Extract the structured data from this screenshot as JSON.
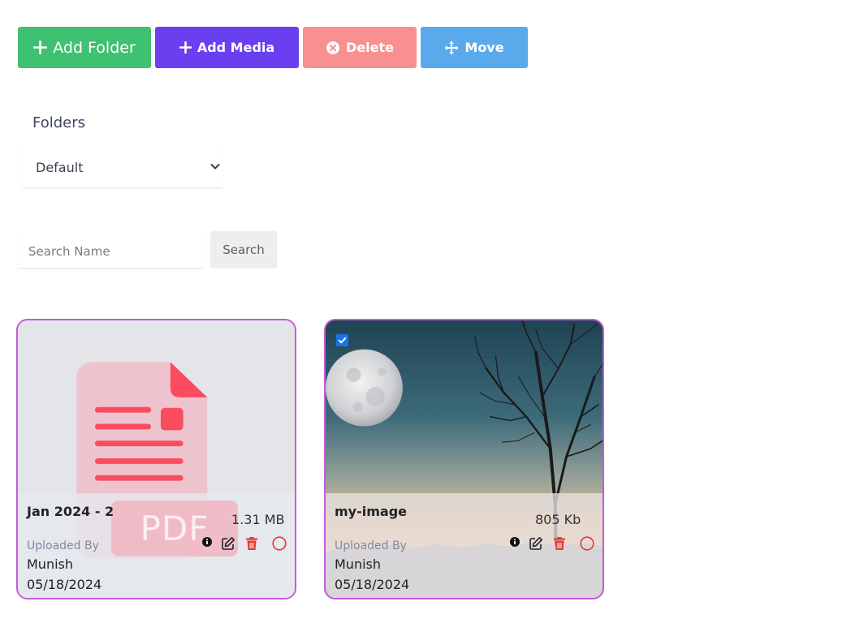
{
  "toolbar": {
    "add_folder_label": "Add Folder",
    "add_media_label": "Add Media",
    "delete_label": "Delete",
    "move_label": "Move"
  },
  "folders": {
    "label": "Folders",
    "selected": "Default"
  },
  "search": {
    "placeholder": "Search Name",
    "button_label": "Search"
  },
  "cards": [
    {
      "name": "Jan 2024 - 2",
      "size": "1.31 MB",
      "uploaded_by_label": "Uploaded By",
      "uploader": "Munish",
      "date": "05/18/2024",
      "thumb_text": "PDF",
      "thumb_icon": "pdf-file-icon",
      "checked": false
    },
    {
      "name": "my-image",
      "size": "805 Kb",
      "uploaded_by_label": "Uploaded By",
      "uploader": "Munish",
      "date": "05/18/2024",
      "thumb_icon": "moon-tree-image",
      "checked": true
    }
  ],
  "colors": {
    "add_folder": "#3ec170",
    "add_media": "#6a3ff0",
    "delete": "#f89090",
    "move": "#5aa9ea",
    "card_border": "#c45ad9",
    "trash": "#e53935"
  }
}
